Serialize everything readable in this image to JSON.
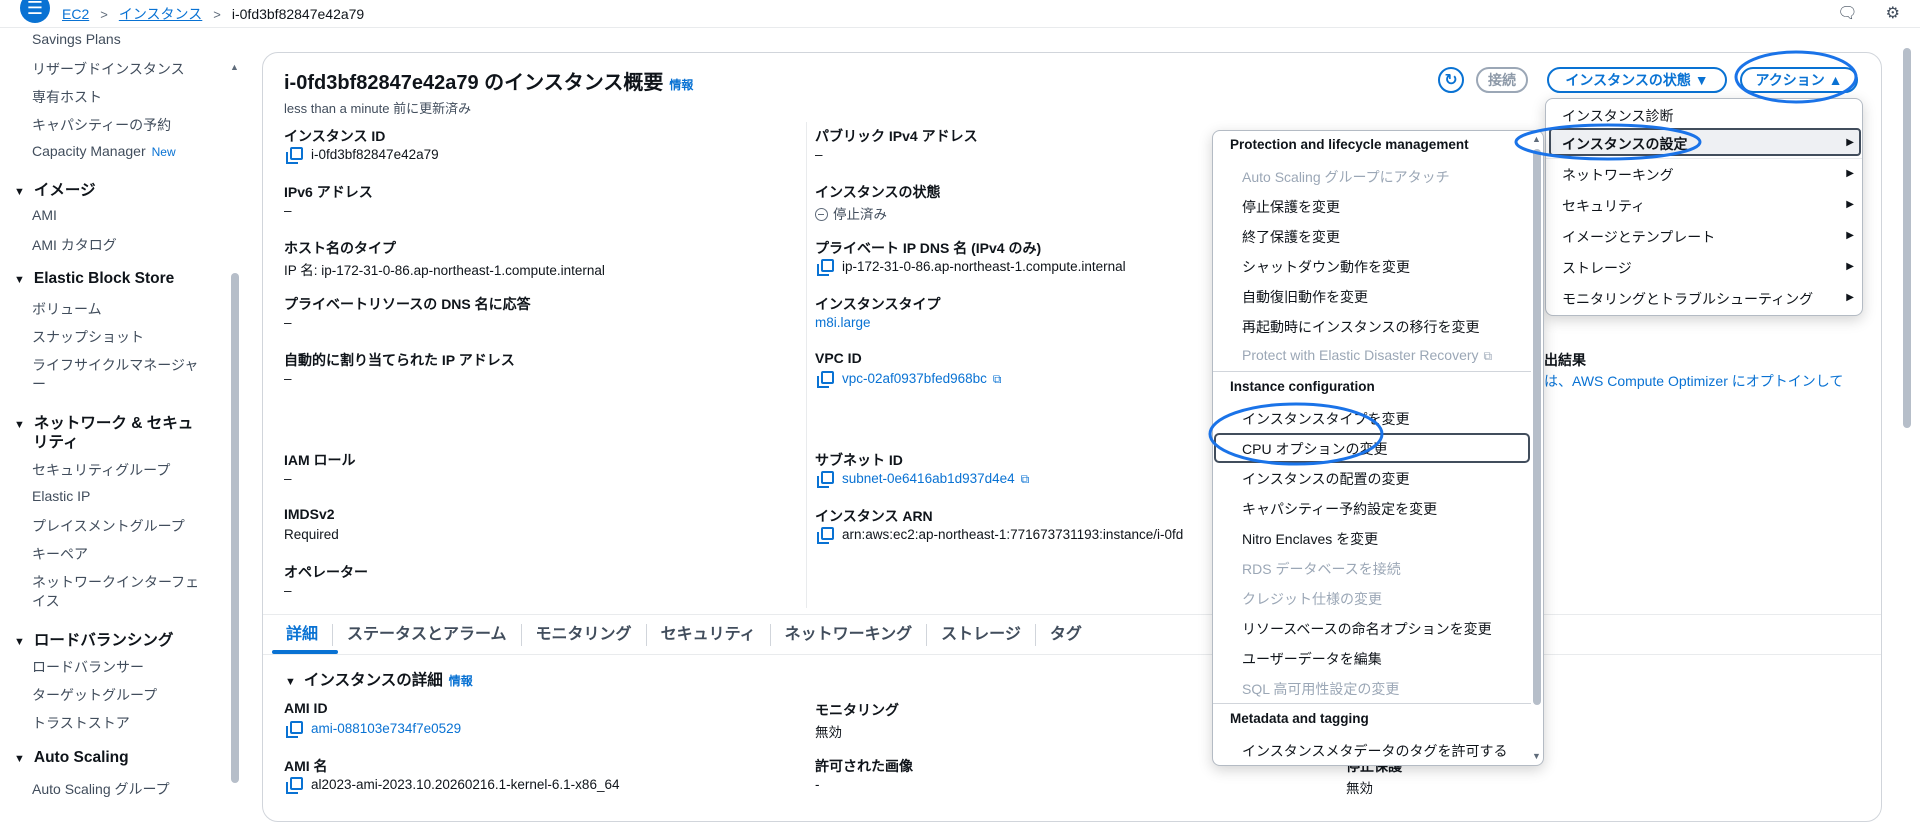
{
  "topbar": {
    "crumbs": [
      "EC2",
      "インスタンス",
      "i-0fd3bf82847e42a79"
    ]
  },
  "sidebar": {
    "items_top": [
      "Savings Plans",
      "リザーブドインスタンス",
      "専有ホスト",
      "キャパシティーの予約",
      "Capacity Manager"
    ],
    "new_badge": "New",
    "sections": [
      {
        "title": "イメージ",
        "items": [
          "AMI",
          "AMI カタログ"
        ]
      },
      {
        "title": "Elastic Block Store",
        "items": [
          "ボリューム",
          "スナップショット",
          "ライフサイクルマネージャ",
          "ー"
        ]
      },
      {
        "title_line1": "ネットワーク & セキュ",
        "title_line2": "リティ",
        "items": [
          "セキュリティグループ",
          "Elastic IP",
          "プレイスメントグループ",
          "キーペア",
          "ネットワークインターフェ",
          "イス"
        ]
      },
      {
        "title": "ロードバランシング",
        "items": [
          "ロードバランサー",
          "ターゲットグループ",
          "トラストストア"
        ]
      },
      {
        "title": "Auto Scaling",
        "items": [
          "Auto Scaling グループ"
        ]
      }
    ]
  },
  "header": {
    "title": "i-0fd3bf82847e42a79 のインスタンス概要",
    "info": "情報",
    "updated": "less than a minute 前に更新済み",
    "connect": "接続",
    "instance_state": "インスタンスの状態 ▼",
    "actions": "アクション ▲"
  },
  "summary": {
    "instance_id_label": "インスタンス ID",
    "instance_id": "i-0fd3bf82847e42a79",
    "ipv6_label": "IPv6 アドレス",
    "ipv6": "–",
    "hostname_type_label": "ホスト名のタイプ",
    "hostname_type": "IP 名: ip-172-31-0-86.ap-northeast-1.compute.internal",
    "private_dns_label": "プライベートリソースの DNS 名に応答",
    "private_dns": "–",
    "auto_ip_label": "自動的に割り当てられた IP アドレス",
    "auto_ip": "–",
    "iam_label": "IAM ロール",
    "iam": "–",
    "imds_label": "IMDSv2",
    "imds": "Required",
    "operator_label": "オペレーター",
    "operator": "–",
    "public_ipv4_label": "パブリック IPv4 アドレス",
    "public_ipv4": "–",
    "state_label": "インスタンスの状態",
    "state": "停止済み",
    "private_ip_dns_label": "プライベート IP DNS 名 (IPv4 のみ)",
    "private_ip_dns": "ip-172-31-0-86.ap-northeast-1.compute.internal",
    "instance_type_label": "インスタンスタイプ",
    "instance_type": "m8i.large",
    "vpc_label": "VPC ID",
    "vpc": "vpc-02af0937bfed968bc",
    "subnet_label": "サブネット ID",
    "subnet": "subnet-0e6416ab1d937d4e4",
    "arn_label": "インスタンス ARN",
    "arn": "arn:aws:ec2:ap-northeast-1:771673731193:instance/i-0fd",
    "optimizer_label": "出結果",
    "optimizer_text": "は、AWS Compute Optimizer にオプトインして"
  },
  "tabs": [
    "詳細",
    "ステータスとアラーム",
    "モニタリング",
    "セキュリティ",
    "ネットワーキング",
    "ストレージ",
    "タグ"
  ],
  "details": {
    "section_title": "インスタンスの詳細",
    "info": "情報",
    "ami_id_label": "AMI ID",
    "ami_id": "ami-088103e734f7e0529",
    "ami_name_label": "AMI 名",
    "ami_name": "al2023-ami-2023.10.20260216.1-kernel-6.1-x86_64",
    "monitoring_label": "モニタリング",
    "monitoring": "無効",
    "allowed_image_label": "許可された画像",
    "allowed_image": "-",
    "right_partial_label": "停止保護",
    "right_partial": "無効"
  },
  "actions_menu": {
    "items": [
      "インスタンス診断",
      "インスタンスの設定",
      "ネットワーキング",
      "セキュリティ",
      "イメージとテンプレート",
      "ストレージ",
      "モニタリングとトラブルシューティング"
    ]
  },
  "instance_settings_menu": {
    "group1": "Protection and lifecycle management",
    "group1_items": [
      {
        "label": "Auto Scaling グループにアタッチ",
        "disabled": true
      },
      {
        "label": "停止保護を変更",
        "disabled": false
      },
      {
        "label": "終了保護を変更",
        "disabled": false
      },
      {
        "label": "シャットダウン動作を変更",
        "disabled": false
      },
      {
        "label": "自動復旧動作を変更",
        "disabled": false
      },
      {
        "label": "再起動時にインスタンスの移行を変更",
        "disabled": false
      },
      {
        "label": "Protect with Elastic Disaster Recovery",
        "disabled": true
      }
    ],
    "group2": "Instance configuration",
    "group2_items": [
      {
        "label": "インスタンスタイプを変更",
        "disabled": false
      },
      {
        "label": "CPU オプションの変更",
        "disabled": false
      },
      {
        "label": "インスタンスの配置の変更",
        "disabled": false
      },
      {
        "label": "キャパシティー予約設定を変更",
        "disabled": false
      },
      {
        "label": "Nitro Enclaves を変更",
        "disabled": false
      },
      {
        "label": "RDS データベースを接続",
        "disabled": true
      },
      {
        "label": "クレジット仕様の変更",
        "disabled": true
      },
      {
        "label": "リソースベースの命名オプションを変更",
        "disabled": false
      },
      {
        "label": "ユーザーデータを編集",
        "disabled": false
      },
      {
        "label": "SQL 高可用性設定の変更",
        "disabled": true
      }
    ],
    "group3": "Metadata and tagging",
    "group3_items": [
      {
        "label": "インスタンスメタデータのタグを許可する",
        "disabled": false
      }
    ]
  },
  "colors": {
    "accent": "#0972d3",
    "annotation": "#1a73e8",
    "disabled": "#9ba7b6"
  }
}
